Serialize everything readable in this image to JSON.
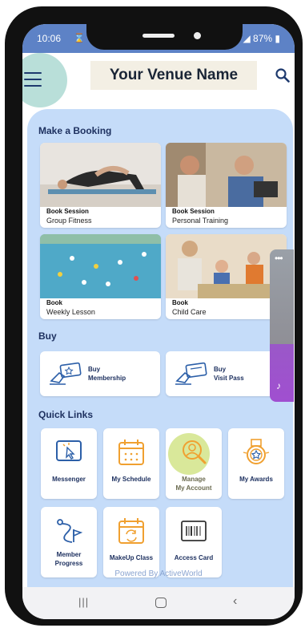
{
  "status": {
    "time": "10:06",
    "left_icons": "⌛ ⚙",
    "battery": "87%"
  },
  "header": {
    "venue_name": "Your Venue Name"
  },
  "booking": {
    "title": "Make a Booking",
    "cards": [
      {
        "line1": "Book Session",
        "line2": "Group Fitness"
      },
      {
        "line1": "Book Session",
        "line2": "Personal Training"
      },
      {
        "line1": "Book",
        "line2": "Weekly Lesson"
      },
      {
        "line1": "Book",
        "line2": "Child Care"
      }
    ]
  },
  "buy": {
    "title": "Buy",
    "items": [
      {
        "line1": "Buy",
        "line2": "Membership"
      },
      {
        "line1": "Buy",
        "line2": "Visit Pass"
      }
    ]
  },
  "quick_links": {
    "title": "Quick Links",
    "items": [
      {
        "label": "Messenger"
      },
      {
        "label": "My Schedule"
      },
      {
        "line1": "Manage",
        "line2": "My Account"
      },
      {
        "label": "My Awards"
      },
      {
        "line1": "Member",
        "line2": "Progress"
      },
      {
        "label": "MakeUp Class"
      },
      {
        "label": "Access Card"
      }
    ]
  },
  "footer": {
    "powered_by": "Powered By ActiveWorld"
  },
  "colors": {
    "accent_orange": "#f0a030",
    "accent_blue": "#2c5fa8",
    "highlight": "#d9e89a"
  }
}
